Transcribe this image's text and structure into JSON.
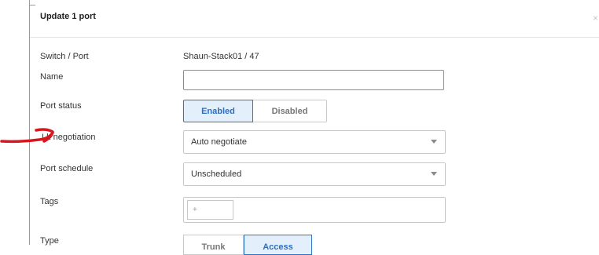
{
  "dialog": {
    "title": "Update 1 port",
    "close_glyph": "×"
  },
  "fields": {
    "switch_port": {
      "label": "Switch / Port",
      "value": "Shaun-Stack01 / 47"
    },
    "name": {
      "label": "Name",
      "value": ""
    },
    "port_status": {
      "label": "Port status",
      "options": [
        "Enabled",
        "Disabled"
      ],
      "selected": "Enabled"
    },
    "link_negotiation": {
      "label": "Link negotiation",
      "visible_label": "Lk negotiation",
      "selected": "Auto negotiate"
    },
    "port_schedule": {
      "label": "Port schedule",
      "selected": "Unscheduled"
    },
    "tags": {
      "label": "Tags",
      "add_glyph": "+"
    },
    "type": {
      "label": "Type",
      "options": [
        "Trunk",
        "Access"
      ],
      "selected": "Access"
    }
  },
  "annotation": {
    "type": "hand-drawn-arrow",
    "color": "#d6181e"
  },
  "colors": {
    "accent": "#2b6fc2",
    "accent_bg": "#e3effb",
    "arrow": "#d6181e"
  },
  "icons": [
    "close-icon",
    "chevron-down-icon",
    "arrow-annotation-icon"
  ]
}
